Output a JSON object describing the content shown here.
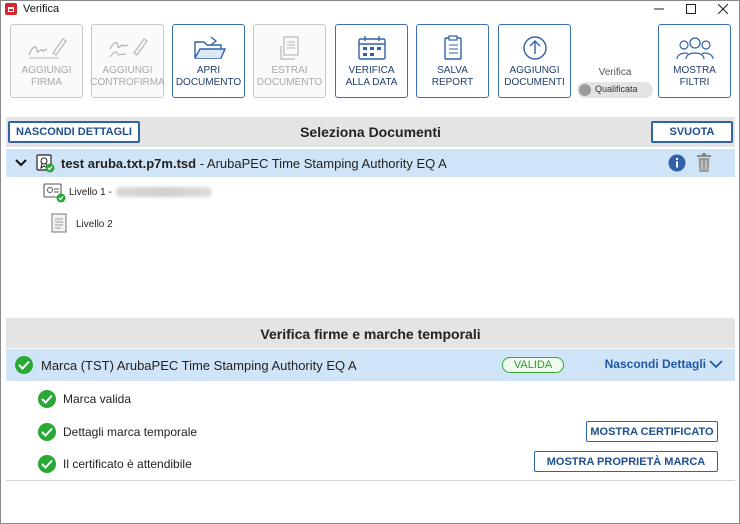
{
  "window": {
    "title": "Verifica",
    "controls": [
      "minimize-icon",
      "maximize-icon",
      "close-icon"
    ]
  },
  "toolbar": {
    "buttons": [
      {
        "label": "AGGIUNGI FIRMA",
        "icon": "signature-pen-icon",
        "enabled": false
      },
      {
        "label": "AGGIUNGI CONTROFIRMA",
        "icon": "countersign-pen-icon",
        "enabled": false
      },
      {
        "label": "APRI DOCUMENTO",
        "icon": "open-folder-icon",
        "enabled": true
      },
      {
        "label": "ESTRAI DOCUMENTO",
        "icon": "extract-document-icon",
        "enabled": false
      },
      {
        "label": "VERIFICA ALLA DATA",
        "icon": "calendar-icon",
        "enabled": true
      },
      {
        "label": "SALVA REPORT",
        "icon": "report-clipboard-icon",
        "enabled": true
      },
      {
        "label": "AGGIUNGI DOCUMENTI",
        "icon": "upload-circle-icon",
        "enabled": true
      },
      {
        "label": "MOSTRA FILTRI",
        "icon": "users-filter-icon",
        "enabled": true
      }
    ],
    "verify_label": "Verifica",
    "verify_toggle": "Qualificata"
  },
  "documents": {
    "hide_details_label": "NASCONDI DETTAGLI",
    "title": "Seleziona Documenti",
    "clear_label": "SVUOTA",
    "file_name": "test aruba.txt.p7m.tsd",
    "file_desc": " - ArubaPEC Time Stamping Authority EQ A",
    "levels": [
      {
        "label": "Livello 1 -"
      },
      {
        "label": "Livello 2"
      }
    ]
  },
  "verification": {
    "title": "Verifica firme e marche temporali",
    "marca_label": "Marca (TST) ArubaPEC Time Stamping Authority EQ A",
    "status": "VALIDA",
    "toggle_label": "Nascondi Dettagli",
    "checks": [
      {
        "text": "Marca valida"
      },
      {
        "text": "Dettagli marca temporale",
        "button": "MOSTRA CERTIFICATO"
      },
      {
        "text": "Il certificato è attendibile",
        "button": "MOSTRA PROPRIETÀ MARCA"
      }
    ]
  },
  "colors": {
    "accent": "#2f62a8",
    "row_highlight": "#cfe4f7",
    "section_bg": "#e4e4e4",
    "valid_green": "#2aa836"
  }
}
